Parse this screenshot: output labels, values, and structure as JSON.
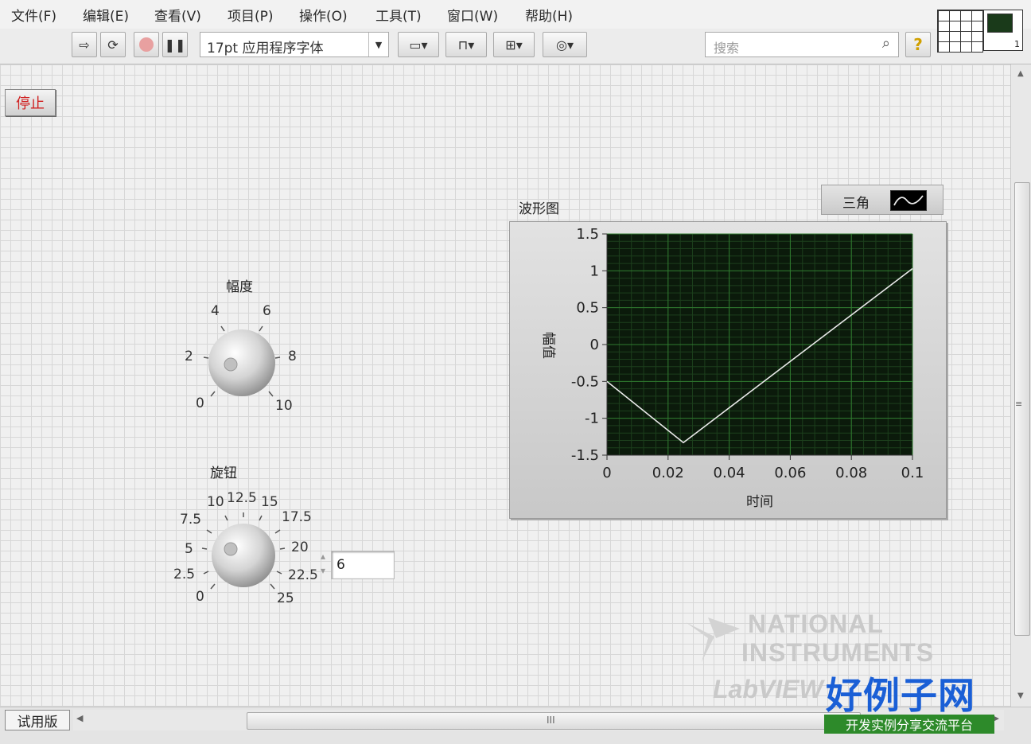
{
  "menu": [
    "文件(F)",
    "编辑(E)",
    "查看(V)",
    "项目(P)",
    "操作(O)",
    "工具(T)",
    "窗口(W)",
    "帮助(H)"
  ],
  "toolbar": {
    "font": "17pt 应用程序字体",
    "search_placeholder": "搜索",
    "help": "?",
    "vi_icon_number": "1"
  },
  "panel": {
    "stop_label": "停止",
    "amplitude": {
      "label": "幅度",
      "ticks": [
        "0",
        "2",
        "4",
        "6",
        "8",
        "10"
      ]
    },
    "knob": {
      "label": "旋钮",
      "ticks": [
        "0",
        "2.5",
        "5",
        "7.5",
        "10",
        "12.5",
        "15",
        "17.5",
        "20",
        "22.5",
        "25"
      ],
      "value": "6"
    },
    "graph": {
      "label": "波形图",
      "legend_name": "三角",
      "xlabel": "时间",
      "ylabel": "幅值"
    }
  },
  "chart_data": {
    "type": "line",
    "title": "波形图",
    "xlabel": "时间",
    "ylabel": "幅值",
    "xlim": [
      0,
      0.1
    ],
    "ylim": [
      -1.5,
      1.5
    ],
    "xticks": [
      "0",
      "0.02",
      "0.04",
      "0.06",
      "0.08",
      "0.1"
    ],
    "yticks": [
      "1.5",
      "1",
      "0.5",
      "0",
      "-0.5",
      "-1",
      "-1.5"
    ],
    "grid": true,
    "legend": "top-right",
    "series": [
      {
        "name": "三角",
        "color": "#e8e8e8",
        "x": [
          0,
          0.025,
          0.1
        ],
        "y": [
          -0.5,
          -1.33,
          1.03
        ]
      }
    ]
  },
  "statusbar": {
    "trial": "试用版",
    "scroll_grip": "III"
  },
  "ni_logo": {
    "line1": "NATIONAL",
    "line2": "INSTRUMENTS",
    "line3": "LabVIEW"
  },
  "watermark": {
    "brand": "好例子网",
    "slogan": "开发实例分享交流平台"
  },
  "colors": {
    "plot_bg": "#0b1a0b",
    "grid_major": "#2f7a2f",
    "grid_minor": "#1c3f1c",
    "stop_text": "#d02020"
  }
}
